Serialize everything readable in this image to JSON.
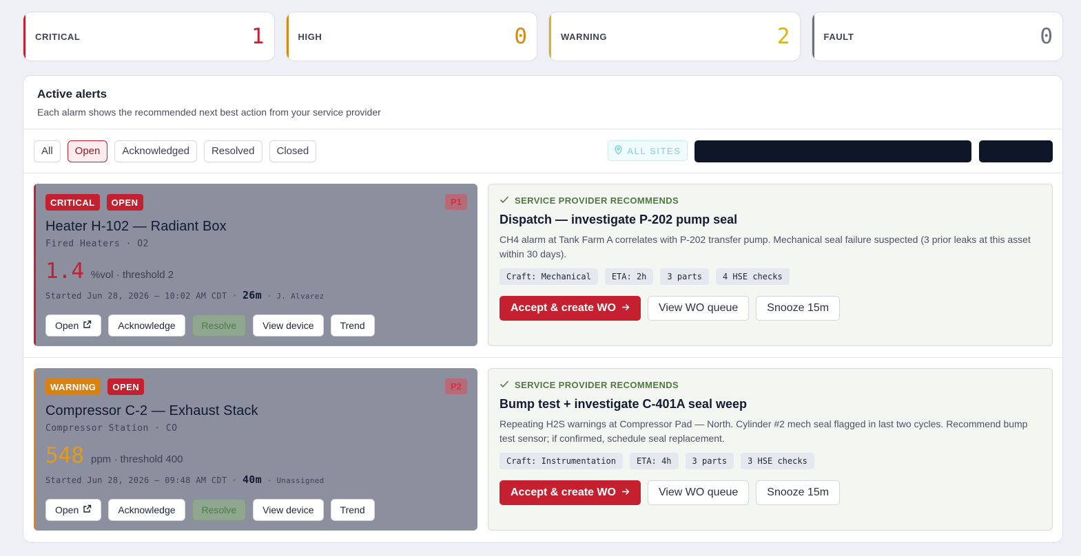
{
  "colors": {
    "critical": "#c4202f",
    "high": "#d9880f",
    "warning": "#d8b41a",
    "fault": "#6b7080",
    "open_badge": "#c4202f",
    "critical_badge": "#c4202f",
    "warning_badge": "#d9820f",
    "critical_value": "#c4202f",
    "warning_value": "#e59a16"
  },
  "summary": [
    {
      "label": "CRITICAL",
      "count": "1"
    },
    {
      "label": "HIGH",
      "count": "0"
    },
    {
      "label": "WARNING",
      "count": "2"
    },
    {
      "label": "FAULT",
      "count": "0"
    }
  ],
  "panel": {
    "title": "Active alerts",
    "subtitle": "Each alarm shows the recommended next best action from your service provider"
  },
  "filters": {
    "items": [
      "All",
      "Open",
      "Acknowledged",
      "Resolved",
      "Closed"
    ],
    "active": "Open",
    "sites_label": "ALL SITES"
  },
  "alerts": [
    {
      "severity": "CRITICAL",
      "status": "OPEN",
      "priority": "P1",
      "title": "Heater H-102 — Radiant Box",
      "subtitle": "Fired Heaters · O2",
      "value": "1.4",
      "unit": "%vol · threshold 2",
      "started": "Started Jun 28, 2026 — 10:02 AM CDT ·",
      "duration": "26m",
      "assignee": "· J. Alvarez",
      "buttons": {
        "open": "Open",
        "ack": "Acknowledge",
        "resolve": "Resolve",
        "device": "View device",
        "trend": "Trend"
      },
      "rec": {
        "header": "SERVICE PROVIDER RECOMMENDS",
        "title": "Dispatch — investigate P-202 pump seal",
        "desc": "CH4 alarm at Tank Farm A correlates with P-202 transfer pump. Mechanical seal failure suspected (3 prior leaks at this asset within 30 days).",
        "chips": [
          "Craft: Mechanical",
          "ETA: 2h",
          "3 parts",
          "4 HSE checks"
        ],
        "accept": "Accept & create WO",
        "queue": "View WO queue",
        "snooze": "Snooze 15m"
      }
    },
    {
      "severity": "WARNING",
      "status": "OPEN",
      "priority": "P2",
      "title": "Compressor C-2 — Exhaust Stack",
      "subtitle": "Compressor Station · CO",
      "value": "548",
      "unit": "ppm · threshold 400",
      "started": "Started Jun 28, 2026 — 09:48 AM CDT ·",
      "duration": "40m",
      "assignee": "· Unassigned",
      "buttons": {
        "open": "Open",
        "ack": "Acknowledge",
        "resolve": "Resolve",
        "device": "View device",
        "trend": "Trend"
      },
      "rec": {
        "header": "SERVICE PROVIDER RECOMMENDS",
        "title": "Bump test + investigate C-401A seal weep",
        "desc": "Repeating H2S warnings at Compressor Pad — North. Cylinder #2 mech seal flagged in last two cycles. Recommend bump test sensor; if confirmed, schedule seal replacement.",
        "chips": [
          "Craft: Instrumentation",
          "ETA: 4h",
          "3 parts",
          "3 HSE checks"
        ],
        "accept": "Accept & create WO",
        "queue": "View WO queue",
        "snooze": "Snooze 15m"
      }
    }
  ]
}
